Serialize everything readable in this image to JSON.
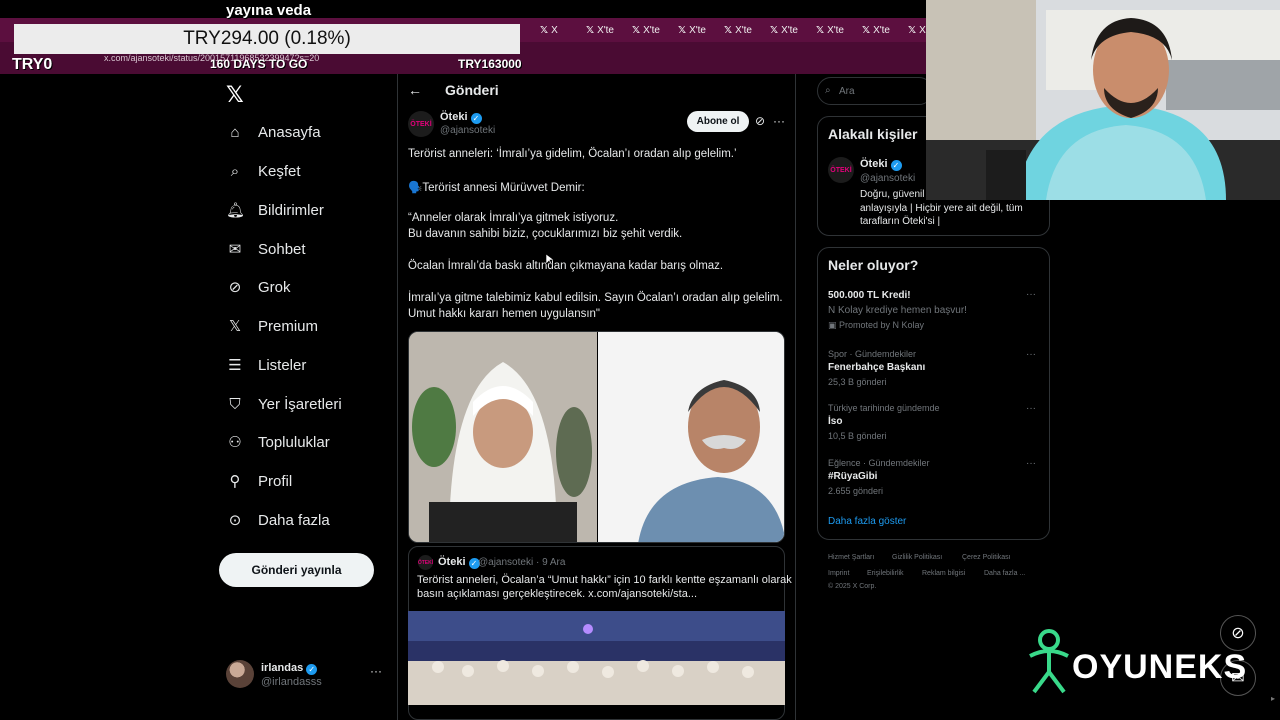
{
  "stream": {
    "title": "yayına veda",
    "price": "TRY294.00 (0.18%)",
    "left_counter": "TRY0",
    "days_label": "160 DAYS TO GO",
    "goal": "TRY163000",
    "brand": "OYUNEKS"
  },
  "browser": {
    "tabs": [
      {
        "icon": "x-icon",
        "label": "X"
      },
      {
        "icon": "x-icon",
        "label": "X'te"
      },
      {
        "icon": "x-icon",
        "label": "X'te"
      },
      {
        "icon": "x-icon",
        "label": "X'te"
      },
      {
        "icon": "x-icon",
        "label": "X'te"
      },
      {
        "icon": "x-icon",
        "label": "X'te"
      },
      {
        "icon": "x-icon",
        "label": "X'te"
      },
      {
        "icon": "x-icon",
        "label": "X'te"
      },
      {
        "icon": "x-icon",
        "label": "X"
      }
    ],
    "url": "x.com/ajansoteki/status/2001571196853239947?s=20"
  },
  "nav": {
    "items": [
      {
        "icon": "home-icon",
        "label": "Anasayfa"
      },
      {
        "icon": "search-icon",
        "label": "Keşfet"
      },
      {
        "icon": "bell-icon",
        "label": "Bildirimler"
      },
      {
        "icon": "mail-icon",
        "label": "Sohbet"
      },
      {
        "icon": "grok-icon",
        "label": "Grok"
      },
      {
        "icon": "x-icon",
        "label": "Premium"
      },
      {
        "icon": "list-icon",
        "label": "Listeler"
      },
      {
        "icon": "bookmark-icon",
        "label": "Yer İşaretleri"
      },
      {
        "icon": "communities-icon",
        "label": "Topluluklar"
      },
      {
        "icon": "profile-icon",
        "label": "Profil"
      },
      {
        "icon": "more-circle-icon",
        "label": "Daha fazla"
      }
    ],
    "post_button": "Gönderi yayınla",
    "user": {
      "name": "irlandas",
      "handle": "@irlandasss"
    }
  },
  "post": {
    "header_title": "Gönderi",
    "author": {
      "name": "Öteki",
      "handle": "@ajansoteki",
      "avatar_text": "ÖTEKİ"
    },
    "subscribe": "Abone ol",
    "lines": [
      "Terörist anneleri: ‘İmralı’ya gidelim, Öcalan’ı oradan alıp gelelim.’",
      "🗣️Terörist annesi Mürüvvet Demir:",
      "“Anneler olarak İmralı’ya gitmek istiyoruz.",
      "Bu davanın sahibi biziz, çocuklarımızı biz şehit verdik.",
      "Öcalan İmralı’da baskı altından çıkmayana kadar barış olmaz.",
      "İmralı’ya gitme talebimiz kabul edilsin. Sayın Öcalan’ı oradan alıp gelelim.",
      "Umut hakkı kararı hemen uygulansın\""
    ],
    "quote": {
      "name": "Öteki",
      "meta": "@ajansoteki · 9 Ara",
      "lines": [
        "Terörist anneleri, Öcalan’a “Umut hakkı” için 10 farklı kentte eşzamanlı olarak",
        "basın açıklaması gerçekleştirecek.  x.com/ajansoteki/sta..."
      ]
    }
  },
  "sidebar": {
    "search_placeholder": "Ara",
    "related": {
      "title": "Alakalı kişiler",
      "name": "Öteki",
      "handle": "@ajansoteki",
      "bio": [
        "Doğru, güvenil",
        "anlayışıyla | Hiçbir yere ait değil, tüm",
        "tarafların Öteki'si |"
      ]
    },
    "trends_title": "Neler oluyor?",
    "trends": [
      {
        "meta": "",
        "title": "500.000 TL Kredi!",
        "sub": "N Kolay krediye hemen başvur!",
        "promo": "Promoted by N Kolay"
      },
      {
        "meta": "Spor · Gündemdekiler",
        "title": "Fenerbahçe Başkanı",
        "sub": "25,3 B gönderi",
        "promo": ""
      },
      {
        "meta": "Türkiye tarihinde gündemde",
        "title": "İso",
        "sub": "10,5 B gönderi",
        "promo": ""
      },
      {
        "meta": "Eğlence · Gündemdekiler",
        "title": "#RüyaGibi",
        "sub": "2.655 gönderi",
        "promo": ""
      }
    ],
    "show_more": "Daha fazla göster",
    "footer": [
      "Hizmet Şartları",
      "Gizlilik Politikası",
      "Çerez Politikası",
      "Imprint",
      "Erişilebilirlik",
      "Reklam bilgisi",
      "Daha fazla ...",
      "© 2025 X Corp."
    ]
  },
  "colors": {
    "accent": "#1d9bf0",
    "tabstrip": "#5c0f3f",
    "brand_green": "#39d98a"
  }
}
